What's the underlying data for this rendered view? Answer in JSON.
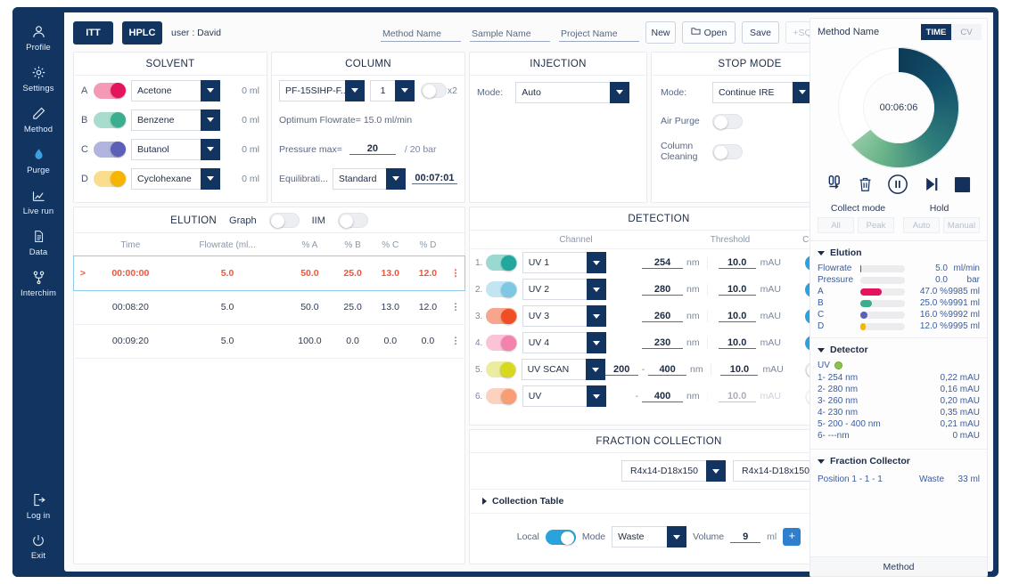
{
  "sidebar": {
    "top_items": [
      {
        "label": "Profile",
        "icon": "user-icon"
      },
      {
        "label": "Settings",
        "icon": "gear-icon"
      },
      {
        "label": "Method",
        "icon": "pencil-icon"
      },
      {
        "label": "Purge",
        "icon": "droplet-icon"
      },
      {
        "label": "Live run",
        "icon": "chart-line-icon"
      },
      {
        "label": "Data",
        "icon": "document-icon"
      },
      {
        "label": "Interchim",
        "icon": "network-icon"
      }
    ],
    "bottom_items": [
      {
        "label": "Log in",
        "icon": "logout-icon"
      },
      {
        "label": "Exit",
        "icon": "power-icon"
      }
    ]
  },
  "toolbar": {
    "tab_itt": "ITT",
    "tab_hplc": "HPLC",
    "user": "user : David",
    "method_name_placeholder": "Method Name",
    "sample_name_placeholder": "Sample Name",
    "project_name_placeholder": "Project Name",
    "new_label": "New",
    "open_label": "Open",
    "save_label": "Save",
    "sq_label": "+SQ"
  },
  "solvent": {
    "title": "SOLVENT",
    "rows": [
      {
        "letter": "A",
        "name": "Acetone",
        "volume": "0 ml",
        "color": "#e3135e",
        "track": "#f49ab6",
        "on": true
      },
      {
        "letter": "B",
        "name": "Benzene",
        "volume": "0 ml",
        "color": "#3bae8f",
        "track": "#a8ddcd",
        "on": true
      },
      {
        "letter": "C",
        "name": "Butanol",
        "volume": "0 ml",
        "color": "#5b5fb5",
        "track": "#b2b4e0",
        "on": true
      },
      {
        "letter": "D",
        "name": "Cyclohexane",
        "volume": "0 ml",
        "color": "#f7b500",
        "track": "#fbdd8e",
        "on": true
      }
    ]
  },
  "column": {
    "title": "COLUMN",
    "column_name": "PF-15SIHP-F...",
    "count": "1",
    "x2_label": "x2",
    "x2_on": false,
    "optimum_flowrate": "Optimum Flowrate=  15.0 ml/min",
    "pressure_label": "Pressure max=",
    "pressure_value": "20",
    "pressure_max": "/ 20 bar",
    "equilibration_label": "Equilibrati...",
    "equilibration_mode": "Standard",
    "equilibration_time": "00:07:01"
  },
  "injection": {
    "title": "INJECTION",
    "mode_label": "Mode:",
    "mode_value": "Auto"
  },
  "stop_mode": {
    "title": "STOP MODE",
    "mode_label": "Mode:",
    "mode_value": "Continue IRE",
    "air_purge_label": "Air Purge",
    "air_purge_on": false,
    "column_cleaning_label": "Column Cleaning",
    "column_cleaning_on": false
  },
  "elution": {
    "title": "ELUTION",
    "graph_label": "Graph",
    "graph_on": false,
    "iim_label": "IIM",
    "iim_on": false,
    "columns": [
      "Time",
      "Flowrate (ml...",
      "% A",
      "% B",
      "% C",
      "% D"
    ],
    "rows": [
      {
        "active": true,
        "time": "00:00:00",
        "flowrate": "5.0",
        "a": "50.0",
        "b": "25.0",
        "c": "13.0",
        "d": "12.0"
      },
      {
        "active": false,
        "time": "00:08:20",
        "flowrate": "5.0",
        "a": "50.0",
        "b": "25.0",
        "c": "13.0",
        "d": "12.0"
      },
      {
        "active": false,
        "time": "00:09:20",
        "flowrate": "5.0",
        "a": "100.0",
        "b": "0.0",
        "c": "0.0",
        "d": "0.0"
      }
    ]
  },
  "detection": {
    "title": "DETECTION",
    "head_channel": "Channel",
    "head_threshold": "Threshold",
    "head_col": "Col.",
    "unit_nm": "nm",
    "unit_mau": "mAU",
    "rows": [
      {
        "num": "1.",
        "channel": "UV 1",
        "wl_from": "",
        "wl_to": "254",
        "range": false,
        "threshold": "10.0",
        "color": "#21a79b",
        "track": "#9ad8d2",
        "chan_on": true,
        "col_on": true,
        "faded": false
      },
      {
        "num": "2.",
        "channel": "UV 2",
        "wl_from": "",
        "wl_to": "280",
        "range": false,
        "threshold": "10.0",
        "color": "#7ec8e3",
        "track": "#c3e4f2",
        "chan_on": true,
        "col_on": true,
        "faded": false
      },
      {
        "num": "3.",
        "channel": "UV 3",
        "wl_from": "",
        "wl_to": "260",
        "range": false,
        "threshold": "10.0",
        "color": "#f04e23",
        "track": "#f7a58c",
        "chan_on": true,
        "col_on": true,
        "faded": false
      },
      {
        "num": "4.",
        "channel": "UV 4",
        "wl_from": "",
        "wl_to": "230",
        "range": false,
        "threshold": "10.0",
        "color": "#f283ae",
        "track": "#fac3d6",
        "chan_on": true,
        "col_on": true,
        "faded": false
      },
      {
        "num": "5.",
        "channel": "UV SCAN",
        "wl_from": "200",
        "wl_to": "400",
        "range": true,
        "threshold": "10.0",
        "color": "#d8d81c",
        "track": "#ececa0",
        "chan_on": true,
        "col_on": false,
        "faded": false
      },
      {
        "num": "6.",
        "channel": "UV",
        "wl_from": "",
        "wl_to": "400",
        "range": true,
        "threshold": "10.0",
        "color": "#f79e77",
        "track": "#fbd2c0",
        "chan_on": true,
        "col_on": false,
        "faded": true
      }
    ]
  },
  "fraction_collection": {
    "title": "FRACTION COLLECTION",
    "rack_left": "R4x14-D18x150",
    "rack_right": "R4x14-D18x150",
    "collection_table_label": "Collection Table",
    "local_label": "Local",
    "local_on": true,
    "mode_label": "Mode",
    "mode_value": "Waste",
    "volume_label": "Volume",
    "volume_value": "9",
    "volume_unit": "ml",
    "plus_label": "+"
  },
  "right_panel": {
    "method_name": "Method Name",
    "tab_time": "TIME",
    "tab_cv": "CV",
    "timer": "00:06:06",
    "progress_deg": 232,
    "icons": [
      {
        "name": "collect-tubes-icon"
      },
      {
        "name": "trash-icon"
      },
      {
        "name": "pause-icon"
      },
      {
        "name": "skip-next-icon"
      },
      {
        "name": "stop-icon"
      }
    ],
    "collect_mode_label": "Collect mode",
    "hold_label": "Hold",
    "collect_buttons": [
      "All",
      "Peak"
    ],
    "hold_buttons": [
      "Auto",
      "Manual"
    ],
    "elution": {
      "title": "Elution",
      "rows": [
        {
          "key": "Flowrate",
          "pct": 2,
          "value": "5.0",
          "unit": "ml/min",
          "color": "#3b5c9b",
          "bar": true,
          "right": ""
        },
        {
          "key": "Pressure",
          "pct": 0,
          "value": "0.0",
          "unit": "bar",
          "color": "#3b5c9b",
          "bar": true,
          "right": ""
        },
        {
          "key": "A",
          "pct": 47,
          "value": "47.0 %",
          "unit": "9985 ml",
          "color": "#e3135e",
          "bar": true,
          "right": ""
        },
        {
          "key": "B",
          "pct": 25,
          "value": "25.0 %",
          "unit": "9991 ml",
          "color": "#3bae8f",
          "bar": true,
          "right": ""
        },
        {
          "key": "C",
          "pct": 16,
          "value": "16.0 %",
          "unit": "9992 ml",
          "color": "#5b5fb5",
          "bar": true,
          "right": ""
        },
        {
          "key": "D",
          "pct": 12,
          "value": "12.0 %",
          "unit": "9995 ml",
          "color": "#f7b500",
          "bar": true,
          "right": ""
        }
      ]
    },
    "detector": {
      "title": "Detector",
      "uv_label": "UV",
      "status_color": "#8ac44a",
      "rows": [
        {
          "label": "1-  254 nm",
          "value": "0,22 mAU"
        },
        {
          "label": "2-  280 nm",
          "value": "0,16 mAU"
        },
        {
          "label": "3-  260 nm",
          "value": "0,20 mAU"
        },
        {
          "label": "4-  230 nm",
          "value": "0,35 mAU"
        },
        {
          "label": "5-   200 - 400 nm",
          "value": "0,21 mAU"
        },
        {
          "label": "6-  ---nm",
          "value": "0 mAU"
        }
      ]
    },
    "fraction_collector": {
      "title": "Fraction Collector",
      "position_label": "Position   1 - 1 - 1",
      "waste_label": "Waste",
      "waste_volume": "33 ml"
    },
    "method_footer": "Method"
  },
  "colors": {
    "navy": "#123460",
    "accent_blue": "#2aa3dd",
    "active_row_text": "#f0553d"
  }
}
